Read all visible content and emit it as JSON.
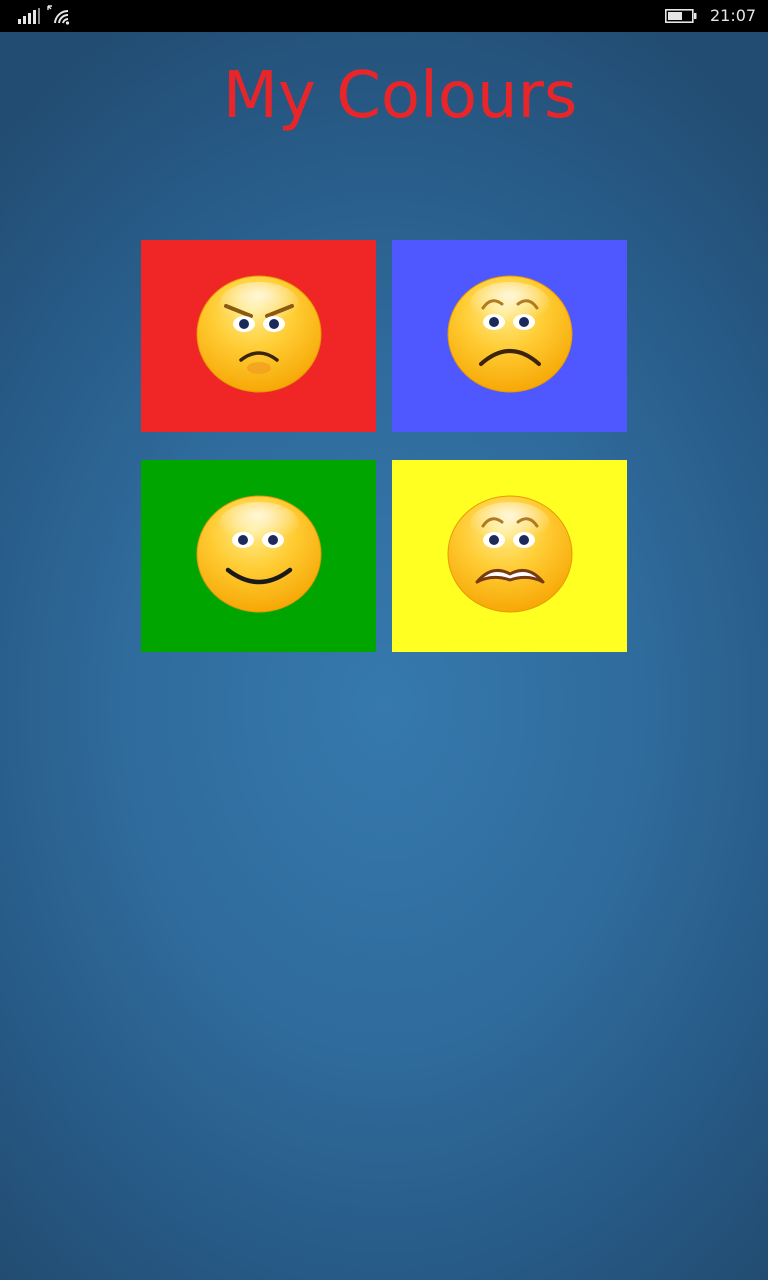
{
  "status_bar": {
    "time": "21:07",
    "icons": [
      "signal-strength-icon",
      "wifi-icon",
      "battery-icon"
    ]
  },
  "page": {
    "title": "My Colours",
    "title_color": "#e8262a"
  },
  "tiles": [
    {
      "color": "#f02626",
      "emoji": "angry-face-icon"
    },
    {
      "color": "#4f58ff",
      "emoji": "worried-face-icon"
    },
    {
      "color": "#00a500",
      "emoji": "smiling-face-icon"
    },
    {
      "color": "#ffff22",
      "emoji": "anxious-face-icon"
    }
  ]
}
